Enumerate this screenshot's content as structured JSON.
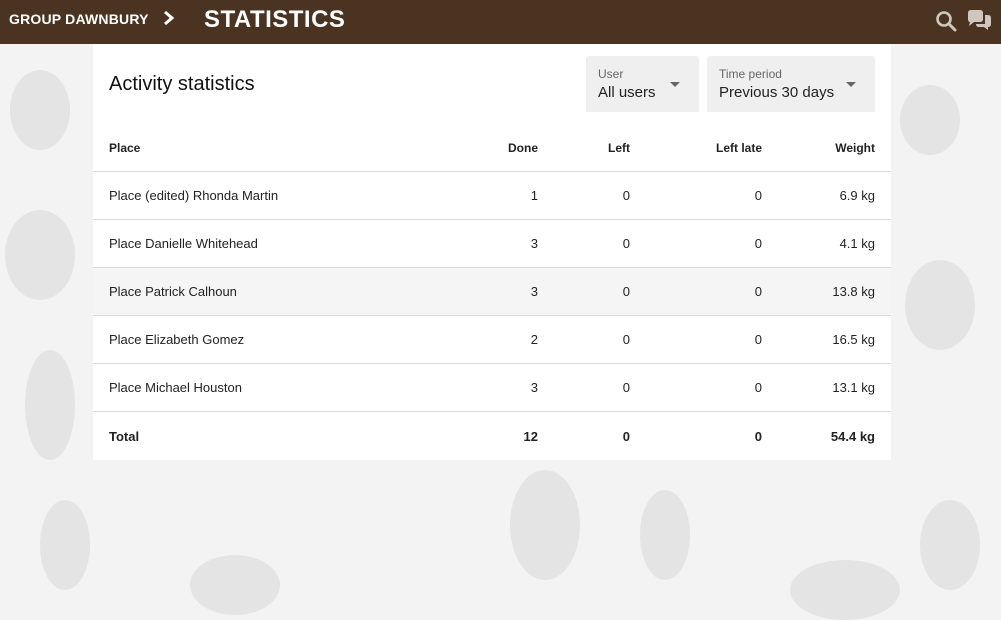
{
  "header": {
    "group_name": "GROUP DAWNBURY",
    "page_title": "STATISTICS"
  },
  "card": {
    "title": "Activity statistics",
    "filters": {
      "user": {
        "label": "User",
        "value": "All users"
      },
      "period": {
        "label": "Time period",
        "value": "Previous 30 days"
      }
    },
    "columns": {
      "place": "Place",
      "done": "Done",
      "left": "Left",
      "left_late": "Left late",
      "weight": "Weight"
    },
    "rows": [
      {
        "place": "Place (edited) Rhonda Martin",
        "done": "1",
        "left": "0",
        "left_late": "0",
        "weight": "6.9 kg"
      },
      {
        "place": "Place Danielle Whitehead",
        "done": "3",
        "left": "0",
        "left_late": "0",
        "weight": "4.1 kg"
      },
      {
        "place": "Place Patrick Calhoun",
        "done": "3",
        "left": "0",
        "left_late": "0",
        "weight": "13.8 kg"
      },
      {
        "place": "Place Elizabeth Gomez",
        "done": "2",
        "left": "0",
        "left_late": "0",
        "weight": "16.5 kg"
      },
      {
        "place": "Place Michael Houston",
        "done": "3",
        "left": "0",
        "left_late": "0",
        "weight": "13.1 kg"
      }
    ],
    "total": {
      "place": "Total",
      "done": "12",
      "left": "0",
      "left_late": "0",
      "weight": "54.4 kg"
    }
  },
  "colors": {
    "topbar": "#4a3421",
    "background": "#f3f3f3",
    "row_highlight": "#f5f5f5"
  },
  "icons": {
    "breadcrumb": "chevron-right-icon",
    "search": "search-icon",
    "chat": "chat-icon",
    "select_caret": "caret-down-icon"
  }
}
